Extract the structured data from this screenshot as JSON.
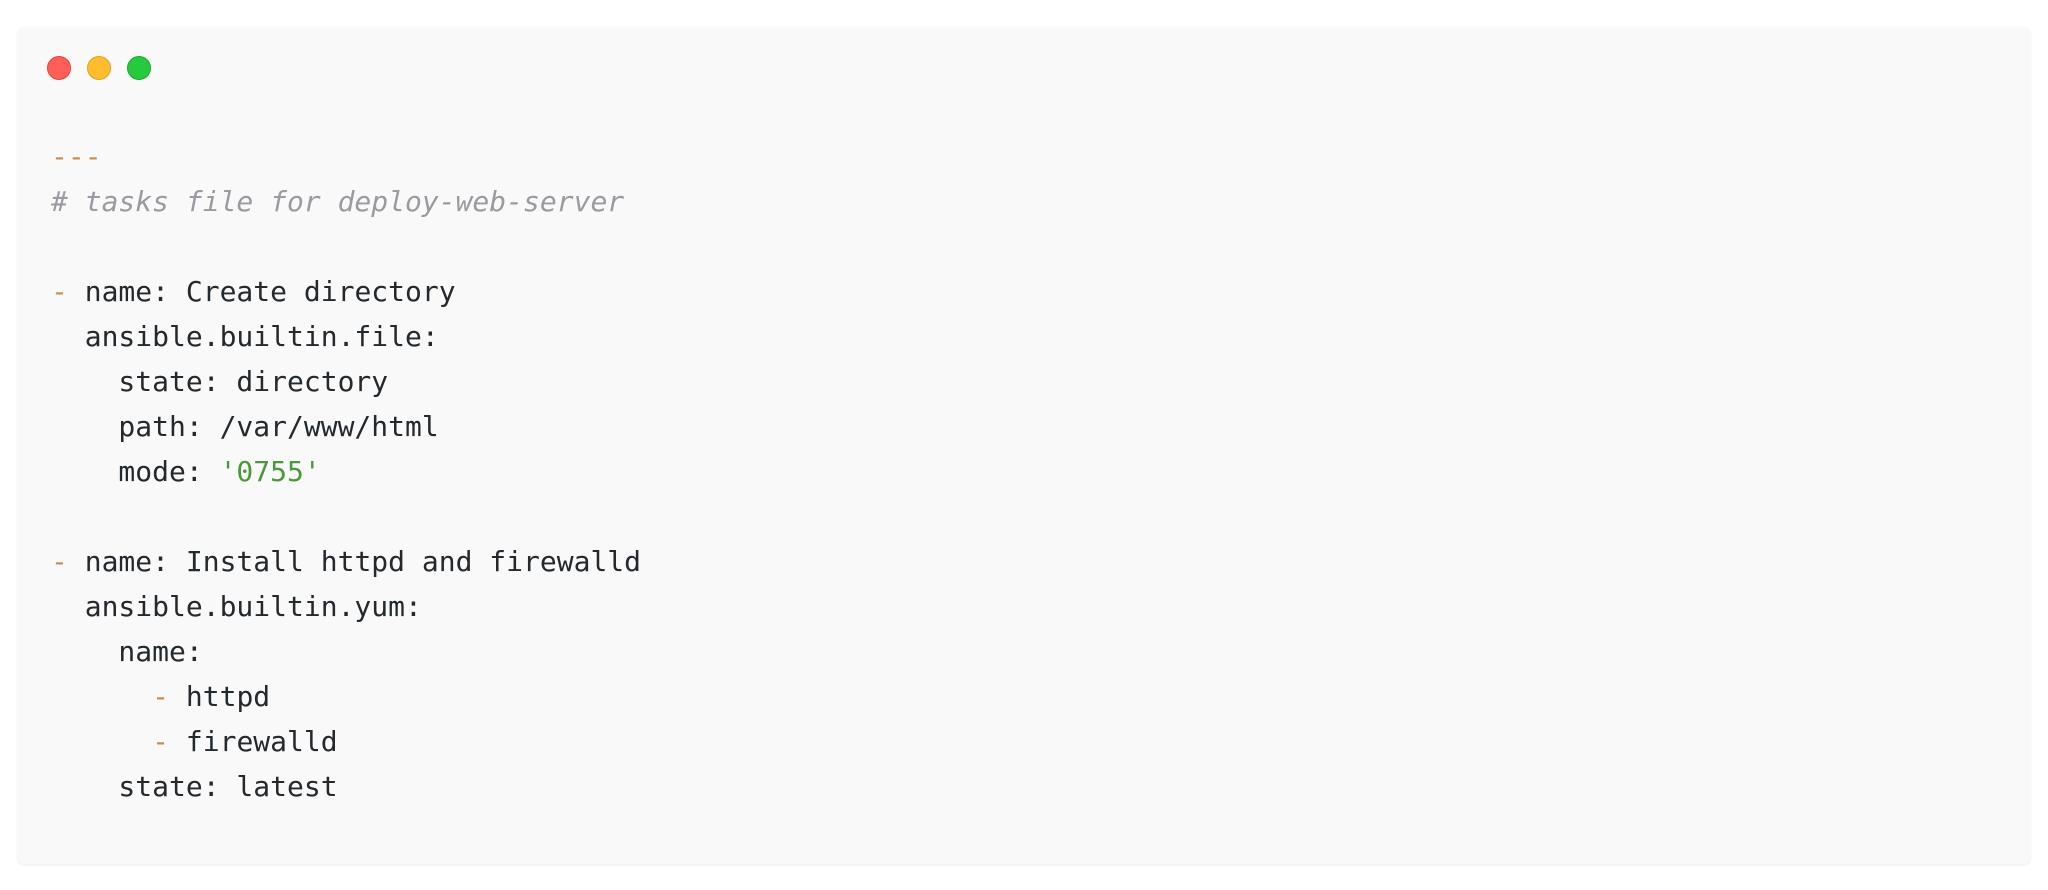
{
  "window": {
    "buttons": {
      "close_icon": "close-icon",
      "minimize_icon": "minimize-icon",
      "zoom_icon": "zoom-icon"
    }
  },
  "colors": {
    "background": "#f9f9f9",
    "text": "#24292e",
    "marker": "#d08b4a",
    "comment": "#9a9ba0",
    "string": "#4a9a3c",
    "close": "#ff5f56",
    "minimize": "#ffbd2e",
    "zoom": "#27c93f"
  },
  "code": {
    "lines": [
      [
        {
          "t": "---",
          "k": "marker"
        }
      ],
      [
        {
          "t": "# tasks file for deploy-web-server",
          "k": "comment"
        }
      ],
      [],
      [
        {
          "t": "- ",
          "k": "marker"
        },
        {
          "t": "name: Create directory",
          "k": "plain"
        }
      ],
      [
        {
          "t": "  ansible.builtin.file:",
          "k": "plain"
        }
      ],
      [
        {
          "t": "    state: directory",
          "k": "plain"
        }
      ],
      [
        {
          "t": "    path: /var/www/html",
          "k": "plain"
        }
      ],
      [
        {
          "t": "    mode: ",
          "k": "plain"
        },
        {
          "t": "'0755'",
          "k": "string"
        }
      ],
      [],
      [
        {
          "t": "- ",
          "k": "marker"
        },
        {
          "t": "name: Install httpd and firewalld",
          "k": "plain"
        }
      ],
      [
        {
          "t": "  ansible.builtin.yum:",
          "k": "plain"
        }
      ],
      [
        {
          "t": "    name:",
          "k": "plain"
        }
      ],
      [
        {
          "t": "      ",
          "k": "plain"
        },
        {
          "t": "- ",
          "k": "marker"
        },
        {
          "t": "httpd",
          "k": "plain"
        }
      ],
      [
        {
          "t": "      ",
          "k": "plain"
        },
        {
          "t": "- ",
          "k": "marker"
        },
        {
          "t": "firewalld",
          "k": "plain"
        }
      ],
      [
        {
          "t": "    state: latest",
          "k": "plain"
        }
      ]
    ]
  }
}
